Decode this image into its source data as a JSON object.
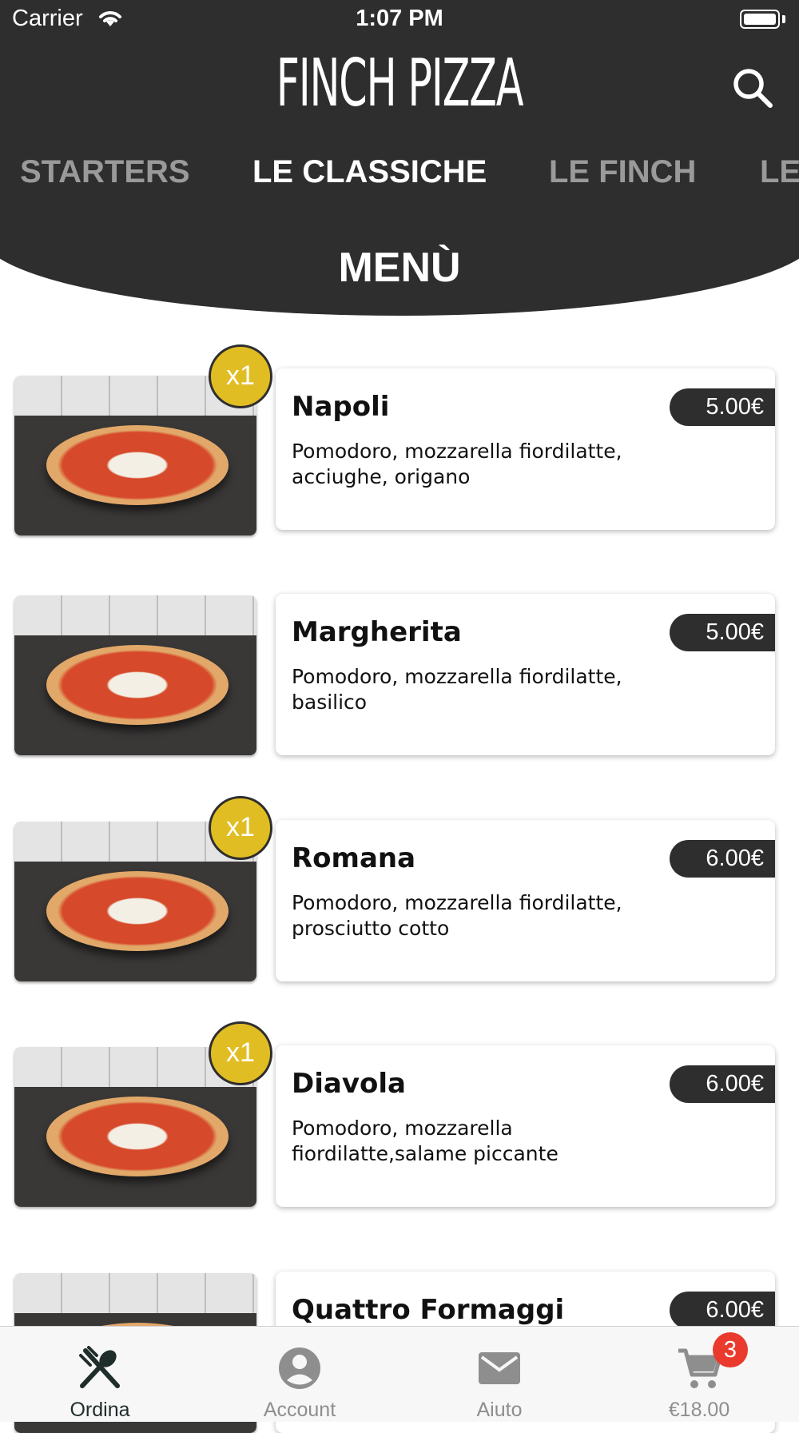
{
  "status_bar": {
    "carrier": "Carrier",
    "time": "1:07 PM"
  },
  "header": {
    "logo": "FINCH PIZZA",
    "tabs": [
      {
        "label": "STARTERS",
        "active": false
      },
      {
        "label": "LE CLASSICHE",
        "active": true
      },
      {
        "label": "LE FINCH",
        "active": false
      },
      {
        "label": "LE",
        "active": false
      }
    ],
    "section_title": "MENÙ",
    "icon": "search-icon"
  },
  "menu": {
    "items": [
      {
        "name": "Napoli",
        "description": "Pomodoro, mozzarella fiordilatte, acciughe, origano",
        "price": "5.00€",
        "quantity_badge": "x1"
      },
      {
        "name": "Margherita",
        "description": "Pomodoro, mozzarella fiordilatte, basilico",
        "price": "5.00€",
        "quantity_badge": ""
      },
      {
        "name": "Romana",
        "description": "Pomodoro, mozzarella fiordilatte, prosciutto cotto",
        "price": "6.00€",
        "quantity_badge": "x1"
      },
      {
        "name": "Diavola",
        "description": "Pomodoro, mozzarella fiordilatte,salame piccante",
        "price": "6.00€",
        "quantity_badge": "x1"
      },
      {
        "name": "Quattro Formaggi",
        "description": "",
        "price": "6.00€",
        "quantity_badge": ""
      }
    ]
  },
  "tab_bar": {
    "items": [
      {
        "label": "Ordina",
        "icon": "fork-spoon-icon",
        "active": true
      },
      {
        "label": "Account",
        "icon": "account-icon",
        "active": false
      },
      {
        "label": "Aiuto",
        "icon": "mail-icon",
        "active": false
      },
      {
        "label": "€18.00",
        "icon": "cart-icon",
        "active": false
      }
    ],
    "cart_badge": "3"
  },
  "colors": {
    "header": "#2f2e2e",
    "badge": "#e1bd24",
    "cart_badge": "#ea3a2e"
  }
}
